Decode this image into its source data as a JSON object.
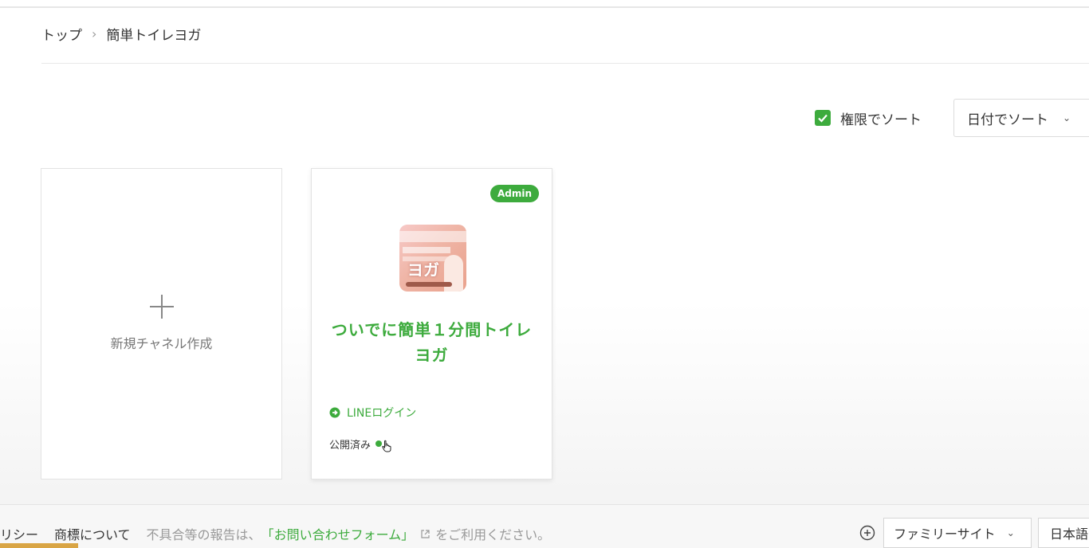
{
  "breadcrumb": {
    "home": "トップ",
    "separator": "›",
    "current": "簡単トイレヨガ"
  },
  "sort": {
    "permission_label": "権限でソート",
    "permission_checked": true,
    "date_select_value": "日付でソート"
  },
  "new_channel": {
    "label": "新規チャネル作成"
  },
  "channel": {
    "badge": "Admin",
    "thumbnail_logo": "ヨガ",
    "title": "ついでに簡単１分間トイレヨガ",
    "login_label": "LINEログイン",
    "status": "公開済み"
  },
  "footer": {
    "policy": "リシー",
    "trademark": "商標について",
    "notice": "不具合等の報告は、",
    "form_link": "「お問い合わせフォーム」",
    "notice_suffix": "をご利用ください。",
    "family_site": "ファミリーサイト",
    "language": "日本語"
  },
  "colors": {
    "accent": "#3dab3d",
    "text": "#333333",
    "muted": "#999999"
  }
}
